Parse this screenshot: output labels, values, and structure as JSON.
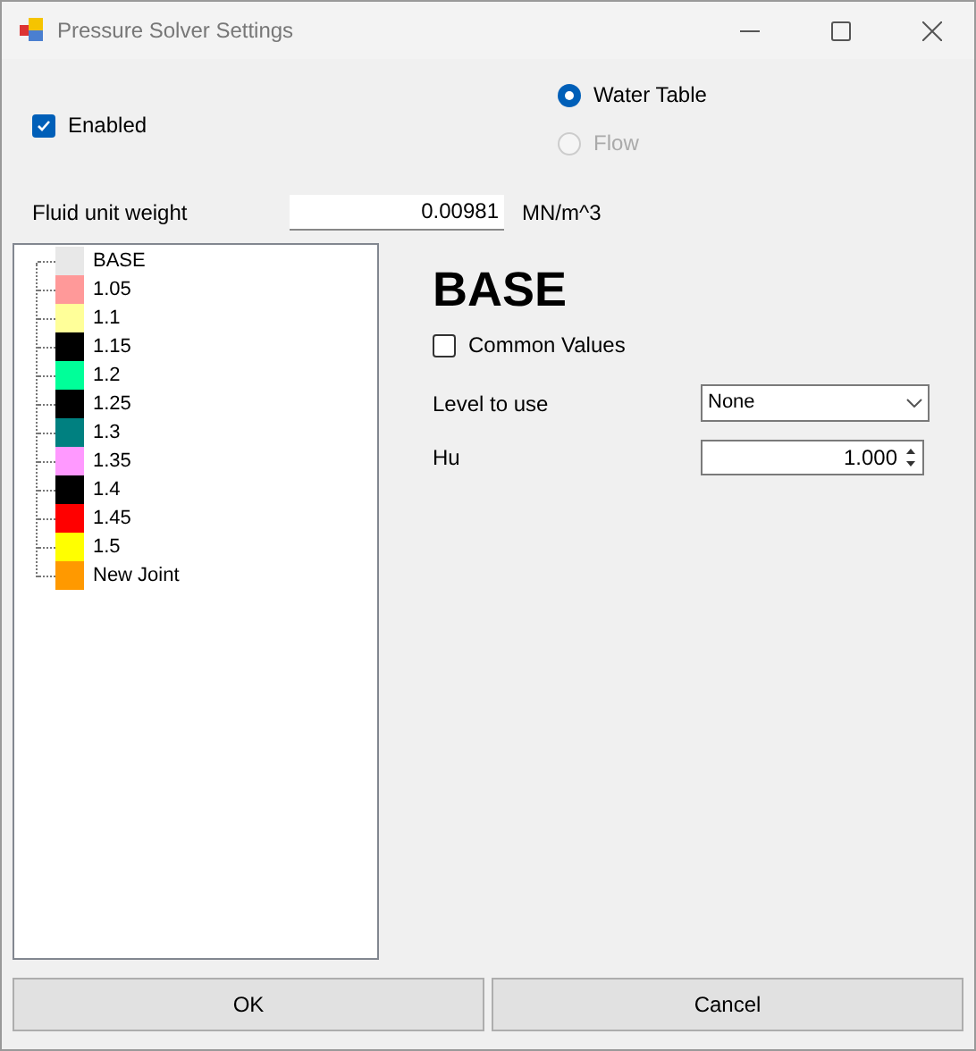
{
  "window": {
    "title": "Pressure Solver Settings"
  },
  "enabled": {
    "label": "Enabled",
    "checked": true
  },
  "mode_options": [
    {
      "label": "Water Table",
      "selected": true,
      "disabled": false
    },
    {
      "label": "Flow",
      "selected": false,
      "disabled": true
    }
  ],
  "fluid_unit_weight": {
    "label": "Fluid unit weight",
    "value": "0.00981",
    "unit": "MN/m^3"
  },
  "joints": [
    {
      "label": "BASE",
      "color": "#e8e8e8",
      "selected": false
    },
    {
      "label": "1.05",
      "color": "#ff9999",
      "selected": false
    },
    {
      "label": "1.1",
      "color": "#ffff99",
      "selected": false
    },
    {
      "label": "1.15",
      "color": "#000000",
      "selected": false
    },
    {
      "label": "1.2",
      "color": "#00ff99",
      "selected": false
    },
    {
      "label": "1.25",
      "color": "#000000",
      "selected": false
    },
    {
      "label": "1.3",
      "color": "#008080",
      "selected": false
    },
    {
      "label": "1.35",
      "color": "#ff99ff",
      "selected": false
    },
    {
      "label": "1.4",
      "color": "#000000",
      "selected": false
    },
    {
      "label": "1.45",
      "color": "#ff0000",
      "selected": false
    },
    {
      "label": "1.5",
      "color": "#ffff00",
      "selected": false
    },
    {
      "label": "New Joint",
      "color": "#ff9900",
      "selected": false
    }
  ],
  "detail": {
    "heading": "BASE",
    "common_values": {
      "label": "Common Values",
      "checked": false
    },
    "level_to_use": {
      "label": "Level to use",
      "value": "None"
    },
    "hu": {
      "label": "Hu",
      "value": "1.000"
    }
  },
  "buttons": [
    "OK",
    "Cancel"
  ]
}
